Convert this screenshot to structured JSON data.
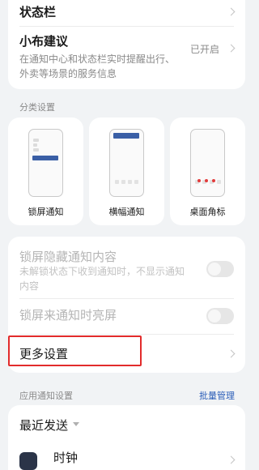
{
  "top_card": {
    "status_bar_label": "状态栏",
    "xiaobu": {
      "title": "小布建议",
      "description": "在通知中心和状态栏实时提醒出行、外卖等场景的服务信息",
      "value": "已开启"
    }
  },
  "category_section": {
    "label": "分类设置",
    "tiles": [
      {
        "label": "锁屏通知",
        "icon": "lockscreen-preview-icon"
      },
      {
        "label": "横幅通知",
        "icon": "banner-preview-icon"
      },
      {
        "label": "桌面角标",
        "icon": "badge-preview-icon"
      }
    ]
  },
  "lock_card": {
    "hide_content": {
      "title": "锁屏隐藏通知内容",
      "description": "未解锁状态下收到通知时，不显示通知内容",
      "enabled": false
    },
    "wake_screen": {
      "title": "锁屏来通知时亮屏",
      "enabled": false
    }
  },
  "more_settings": {
    "label": "更多设置"
  },
  "app_section": {
    "label": "应用通知设置",
    "batch_manage": "批量管理",
    "sort_label": "最近发送",
    "apps": [
      {
        "name": "时钟",
        "icon": "clock-app-icon"
      }
    ]
  },
  "colors": {
    "accent": "#2a5db8",
    "highlight": "#e22b2b",
    "background": "#f1f3f5"
  }
}
